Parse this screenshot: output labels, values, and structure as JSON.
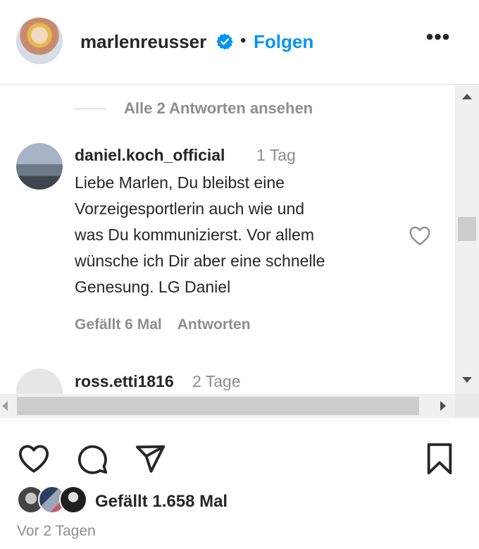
{
  "header": {
    "username": "marlenreusser",
    "separator": "•",
    "follow_label": "Folgen",
    "more_label": "•••",
    "verified_color": "#0095f6"
  },
  "comments_area": {
    "view_replies_label": "Alle 2 Antworten ansehen",
    "comments": [
      {
        "username": "daniel.koch_official",
        "time": "1 Tag",
        "text": "Liebe Marlen, Du bleibst eine\nVorzeigesportlerin auch wie und\nwas Du kommunizierst. Vor allem\nwünsche ich Dir aber eine schnelle\nGenesung. LG Daniel",
        "likes_label": "Gefällt 6 Mal",
        "reply_label": "Antworten"
      },
      {
        "username": "ross.etti1816",
        "time": "2 Tage"
      }
    ]
  },
  "actions": {
    "like_icon": "heart-icon",
    "comment_icon": "comment-icon",
    "share_icon": "paper-plane-icon",
    "save_icon": "bookmark-icon"
  },
  "likes": {
    "label": "Gefällt 1.658 Mal"
  },
  "post_time": "Vor 2 Tagen",
  "colors": {
    "text": "#262626",
    "secondary": "#8e8e8e",
    "link": "#0095f6",
    "scrollbar": "#f0f0f0"
  }
}
